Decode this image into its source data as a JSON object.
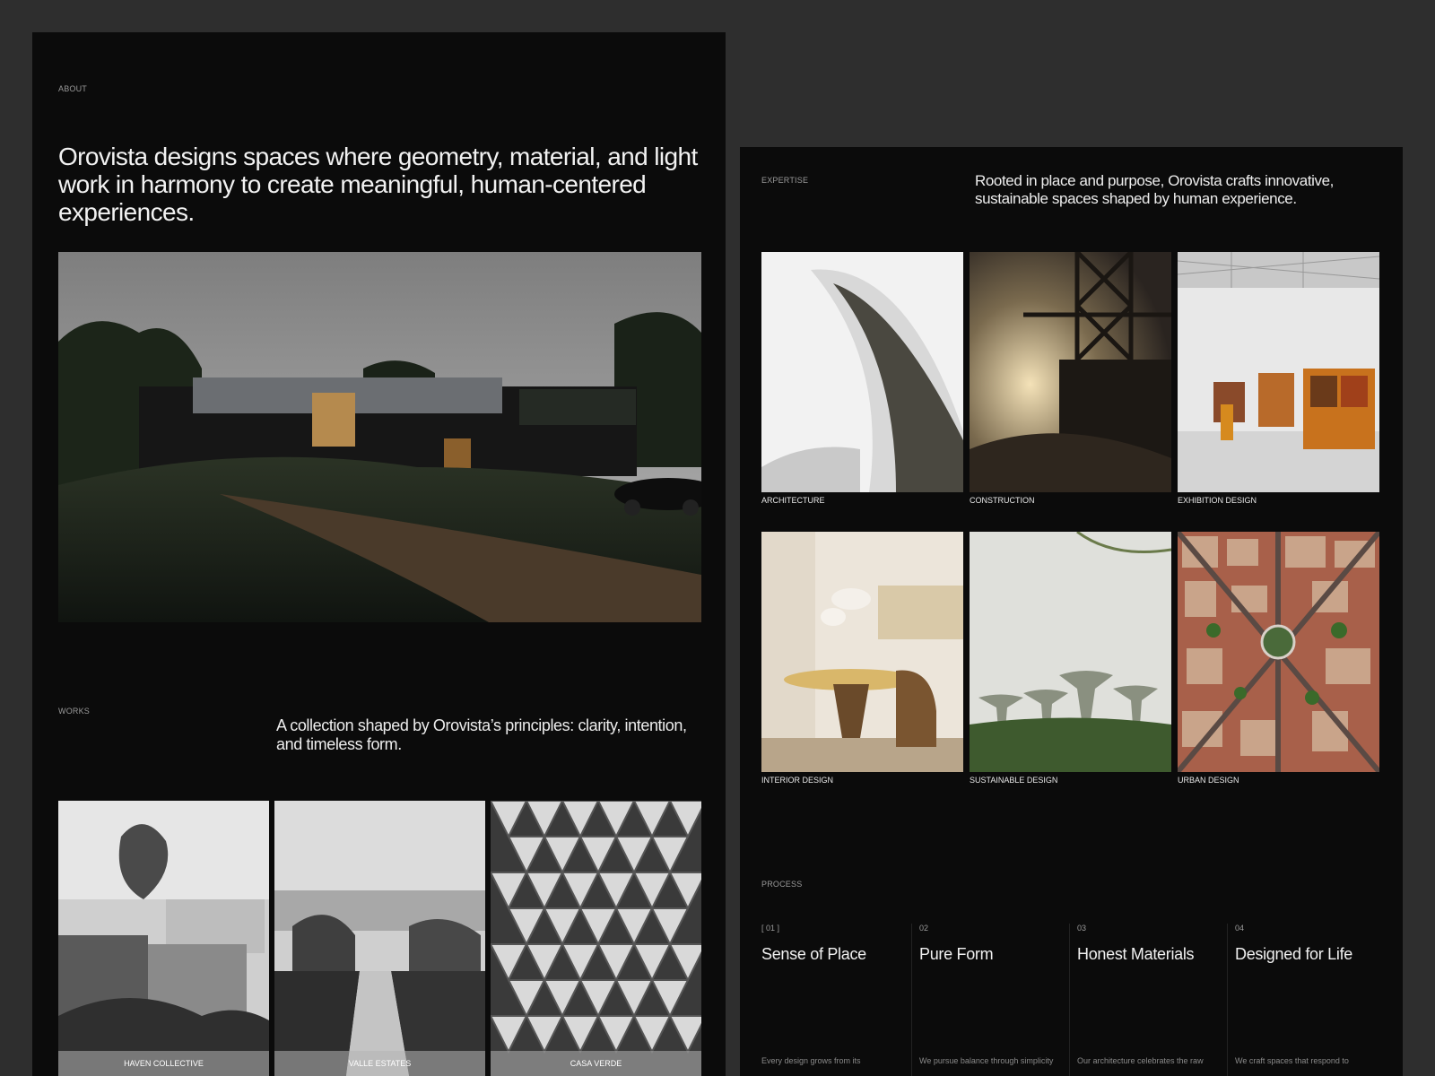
{
  "about": {
    "label": "ABOUT",
    "heading": "Orovista designs spaces where geometry, material, and light work in harmony to create meaningful, human-centered experiences."
  },
  "works": {
    "label": "WORKS",
    "text": "A collection shaped by Orovista’s principles: clarity, intention, and timeless form.",
    "items": [
      {
        "caption": "HAVEN COLLECTIVE"
      },
      {
        "caption": "VALLE ESTATES"
      },
      {
        "caption": "CASA VERDE"
      }
    ]
  },
  "expertise": {
    "label": "EXPERTISE",
    "text": "Rooted in place and purpose, Orovista crafts innovative, sustainable spaces shaped by human experience.",
    "items": [
      {
        "caption": "ARCHITECTURE"
      },
      {
        "caption": "CONSTRUCTION"
      },
      {
        "caption": "EXHIBITION DESIGN"
      },
      {
        "caption": "INTERIOR DESIGN"
      },
      {
        "caption": "SUSTAINABLE DESIGN"
      },
      {
        "caption": "URBAN DESIGN"
      }
    ]
  },
  "process": {
    "label": "PROCESS",
    "steps": [
      {
        "num": "[ 01 ]",
        "title": "Sense of Place",
        "desc": "Every design grows from its"
      },
      {
        "num": "02",
        "title": "Pure Form",
        "desc": "We pursue balance through simplicity"
      },
      {
        "num": "03",
        "title": "Honest Materials",
        "desc": "Our architecture celebrates the raw"
      },
      {
        "num": "04",
        "title": "Designed for Life",
        "desc": "We craft spaces that respond to"
      }
    ]
  },
  "colors": {
    "page_bg": "#2e2e2e",
    "panel_bg": "#0b0b0b",
    "text": "#f2f2f2",
    "muted": "#9a9a9a"
  }
}
